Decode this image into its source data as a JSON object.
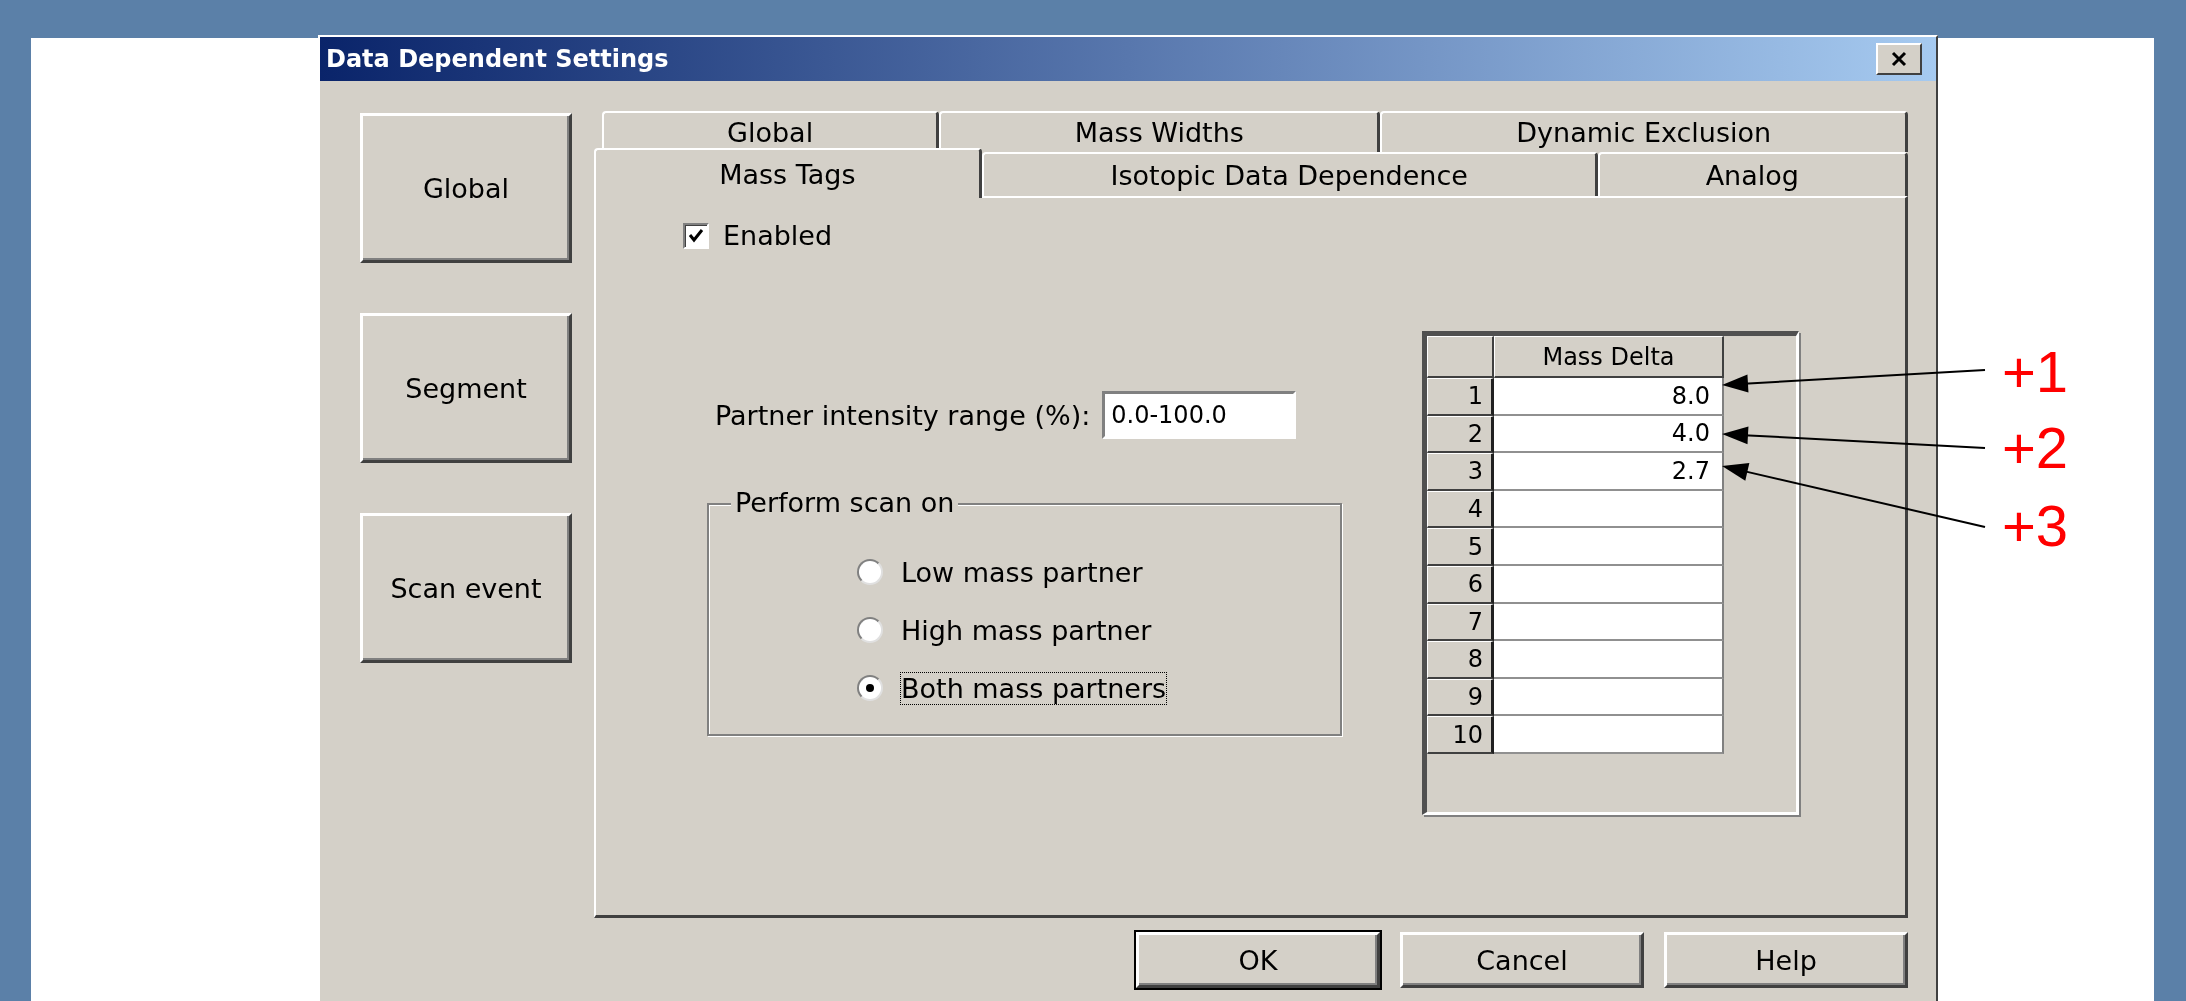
{
  "window": {
    "title": "Data Dependent Settings"
  },
  "side_buttons": [
    {
      "label": "Global"
    },
    {
      "label": "Segment"
    },
    {
      "label": "Scan event"
    }
  ],
  "tab_rows": [
    [
      {
        "label": "Global",
        "selected": false
      },
      {
        "label": "Mass Widths",
        "selected": false
      },
      {
        "label": "Dynamic Exclusion",
        "selected": false
      }
    ],
    [
      {
        "label": "Mass Tags",
        "selected": true
      },
      {
        "label": "Isotopic Data Dependence",
        "selected": false
      },
      {
        "label": "Analog",
        "selected": false
      }
    ]
  ],
  "enabled": {
    "label": "Enabled",
    "checked": true
  },
  "partner_intensity": {
    "label": "Partner intensity range (%):",
    "value": "0.0-100.0"
  },
  "perform_scan": {
    "title": "Perform scan on",
    "options": [
      {
        "label": "Low mass partner",
        "selected": false
      },
      {
        "label": "High mass partner",
        "selected": false
      },
      {
        "label": "Both mass partners",
        "selected": true
      }
    ]
  },
  "table": {
    "columns": [
      "Mass Delta"
    ],
    "rows": [
      {
        "number": "1",
        "value": "8.0"
      },
      {
        "number": "2",
        "value": "4.0"
      },
      {
        "number": "3",
        "value": "2.7"
      },
      {
        "number": "4"
      },
      {
        "number": "5"
      },
      {
        "number": "6"
      },
      {
        "number": "7"
      },
      {
        "number": "8"
      },
      {
        "number": "9"
      },
      {
        "number": "10"
      }
    ]
  },
  "annotations": [
    {
      "label": "+1"
    },
    {
      "label": "+2"
    },
    {
      "label": "+3"
    }
  ],
  "buttons": [
    {
      "label": "OK"
    },
    {
      "label": "Cancel"
    },
    {
      "label": "Help"
    }
  ]
}
